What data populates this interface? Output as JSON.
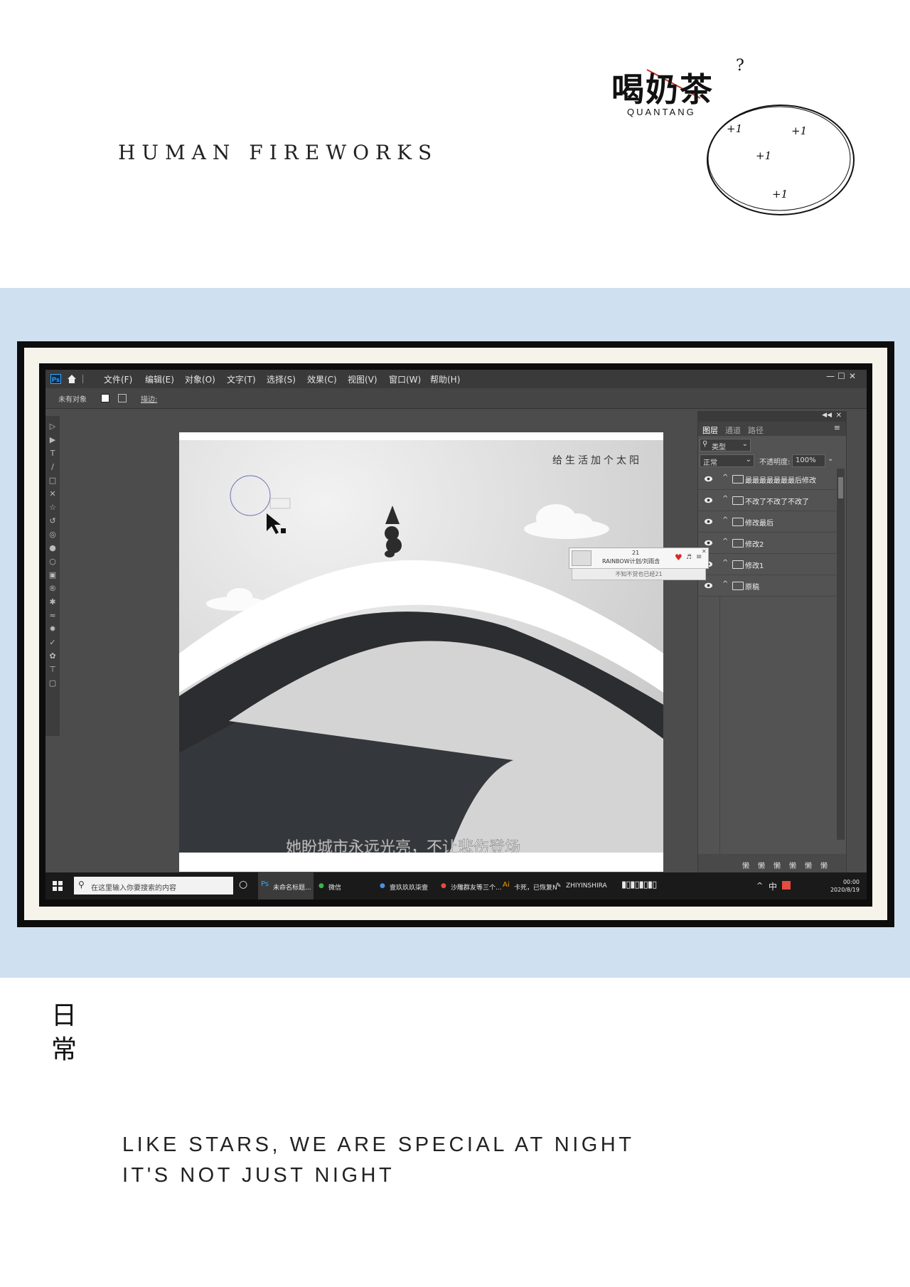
{
  "header": {
    "title": "HUMAN  FIREWORKS",
    "logo_cn": "喝奶茶",
    "logo_question": "?",
    "logo_en": "QUANTANG",
    "plus_marks": [
      "+1",
      "+1",
      "+1",
      "+1"
    ]
  },
  "app": {
    "menu": [
      "文件(F)",
      "编辑(E)",
      "对象(O)",
      "文字(T)",
      "选择(S)",
      "效果(C)",
      "视图(V)",
      "窗口(W)",
      "帮助(H)"
    ],
    "options_bar": {
      "selection": "未有对象",
      "stroke_label": "描边:"
    },
    "artwork": {
      "top_text": "给生活加个太阳",
      "caption": "她盼城市永远光亮，不让悲伤登场"
    },
    "layers_panel": {
      "tabs": [
        "图层",
        "通道",
        "路径"
      ],
      "filter": "类型",
      "blend_mode": "正常",
      "opacity_label": "不透明度:",
      "opacity_value": "100%",
      "layers": [
        "最最最最最最最后修改",
        "不改了不改了不改了",
        "修改最后",
        "修改2",
        "修改1",
        "原稿"
      ],
      "footer_icons": [
        "懒",
        "懒",
        "懒",
        "懒",
        "懒",
        "懒"
      ]
    },
    "music_popup": {
      "count": "21",
      "title": "RAINBOW计划/刘雨含",
      "sub": "不知不觉也已经21"
    },
    "taskbar": {
      "search_placeholder": "在这里输入你要搜索的内容",
      "items": [
        "未命名标题...",
        "微信",
        "壹玖玖玖柒壹",
        "沙雕群友等三个...",
        "卡死，已恢复N",
        "ZHIYINSHIRA"
      ],
      "ime": "中",
      "time": "00:00",
      "date": "2020/8/19"
    }
  },
  "bottom": {
    "vertical_text": [
      "日",
      "常"
    ],
    "line1": "LIKE STARS, WE ARE SPECIAL AT NIGHT",
    "line2": "IT'S NOT JUST NIGHT"
  }
}
